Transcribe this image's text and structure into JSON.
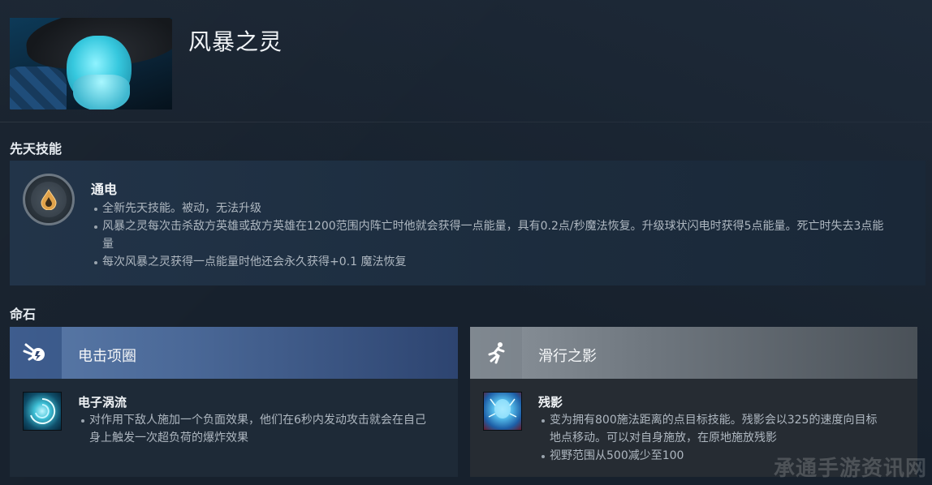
{
  "hero": {
    "name": "风暴之灵"
  },
  "innate_section": {
    "title": "先天技能",
    "ability": {
      "icon": "innate-drop-icon",
      "name": "通电",
      "bullets": [
        "全新先天技能。被动，无法升级",
        "风暴之灵每次击杀敌方英雄或敌方英雄在1200范围内阵亡时他就会获得一点能量，具有0.2点/秒魔法恢复。升级球状闪电时获得5点能量。死亡时失去3点能量",
        "每次风暴之灵获得一点能量时他还会永久获得+0.1 魔法恢复"
      ]
    }
  },
  "facets_section": {
    "title": "命石",
    "facets": [
      {
        "icon": "lightning-burst-icon",
        "title": "电击项圈",
        "ability_icon": "electric-vortex-icon",
        "ability_name": "电子涡流",
        "bullets": [
          "对作用下敌人施加一个负面效果，他们在6秒内发动攻击就会在自己身上触发一次超负荷的爆炸效果"
        ]
      },
      {
        "icon": "running-figure-icon",
        "title": "滑行之影",
        "ability_icon": "static-remnant-icon",
        "ability_name": "残影",
        "bullets": [
          "变为拥有800施法距离的点目标技能。残影会以325的速度向目标地点移动。可以对自身施放，在原地施放残影",
          "视野范围从500减少至100"
        ]
      }
    ]
  },
  "watermark": "承通手游资讯网"
}
